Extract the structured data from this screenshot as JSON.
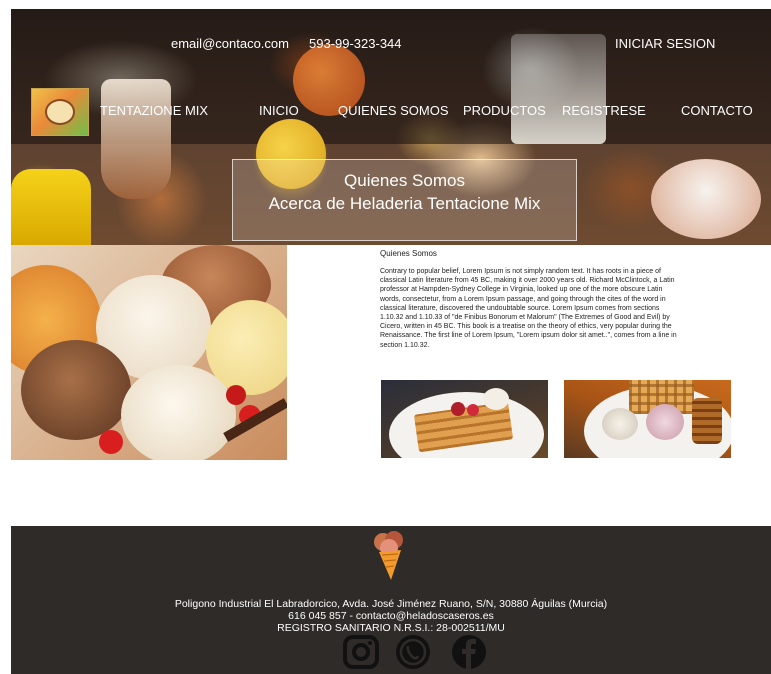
{
  "header": {
    "email": "email@contaco.com",
    "phone": "593-99-323-344",
    "login_label": "INICIAR SESION"
  },
  "nav": {
    "brand": "TENTAZIONE MIX",
    "items": [
      {
        "label": "INICIO"
      },
      {
        "label": "QUIENES SOMOS"
      },
      {
        "label": "PRODUCTOS"
      },
      {
        "label": "REGISTRESE"
      },
      {
        "label": "CONTACTO"
      }
    ]
  },
  "hero": {
    "title": "Quienes Somos",
    "subtitle": "Acerca  de Heladeria Tentacione Mix"
  },
  "about": {
    "heading": "Quienes Somos",
    "body": "Contrary to popular belief, Lorem Ipsum is not simply random text. It has roots in a piece of classical Latin literature from 45 BC, making it over 2000 years old. Richard McClintock, a Latin professor at Hampden-Sydney College in Virginia, looked up one of the more obscure Latin words, consectetur, from a Lorem Ipsum passage, and going through the cites of the word in classical literature, discovered the undoubtable source. Lorem Ipsum comes from sections 1.10.32 and 1.10.33 of \"de Finibus Bonorum et Malorum\" (The Extremes of Good and Evil) by Cicero, written in 45 BC. This book is a treatise on the theory of ethics, very popular during the Renaissance. The first line of Lorem Ipsum, \"Lorem ipsum dolor sit amet..\", comes from a line in section 1.10.32."
  },
  "footer": {
    "address": "Poligono Industrial El Labradorcico, Avda. José Jiménez Ruano, S/N, 30880 Águilas (Murcia)",
    "contact": "616 045 857 -  contacto@heladoscaseros.es",
    "registry": "REGISTRO SANITARIO N.R.S.I.: 28-002511/MU",
    "social_icons": [
      "instagram-icon",
      "whatsapp-icon",
      "facebook-icon"
    ]
  },
  "colors": {
    "footer_bg": "#2f2b28",
    "nav_text": "#ffffff",
    "body_text": "#222222"
  }
}
